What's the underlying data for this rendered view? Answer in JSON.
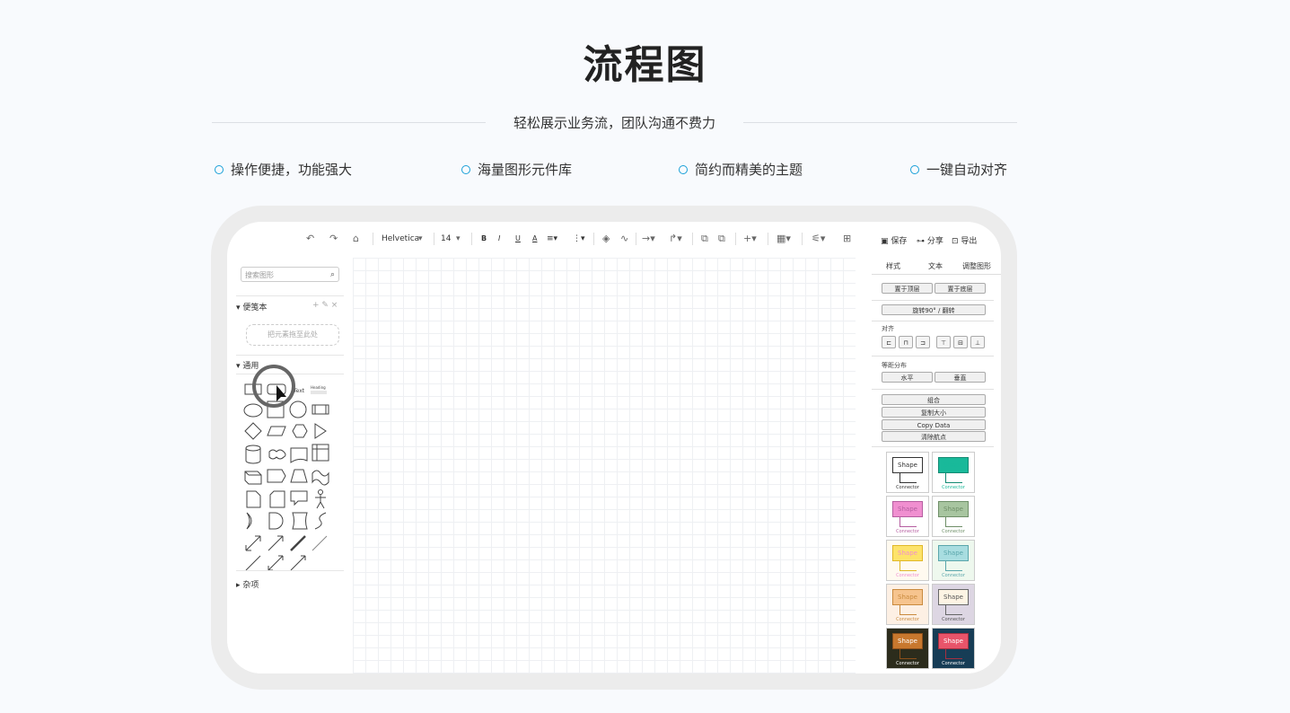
{
  "title": "流程图",
  "subtitle": "轻松展示业务流，团队沟通不费力",
  "features": [
    "操作便捷，功能强大",
    "海量图形元件库",
    "简约而精美的主题",
    "一键自动对齐"
  ],
  "accent_color": "#1aa0d8",
  "editor": {
    "toolbar": {
      "font": "Helvetica",
      "font_size": "14",
      "bold": "B",
      "italic": "I",
      "underline": "U",
      "font_color": "A",
      "save": "保存",
      "share": "分享",
      "export": "导出"
    },
    "left_panel": {
      "search_placeholder": "搜索图形",
      "scratchpad_title": "便笺本",
      "scratchpad_actions": "+ ✎ ×",
      "dropzone_text": "把元素拖至此处",
      "general_title": "通用",
      "misc_title": "杂项",
      "text_shape": "Text",
      "heading_shape": "Heading"
    },
    "right_panel": {
      "tabs": [
        "样式",
        "文本",
        "调整图形"
      ],
      "to_front": "置于顶层",
      "to_back": "置于底层",
      "rotate": "旋转90° / 翻转",
      "align_label": "对齐",
      "distribute_label": "等距分布",
      "horizontal": "水平",
      "vertical": "垂直",
      "group": "组合",
      "copy_size": "复制大小",
      "copy_data": "Copy Data",
      "clear_waypoints": "清除航点",
      "themes": [
        {
          "shape": "Shape",
          "connector": "Connector",
          "fill": "#ffffff",
          "stroke": "#333333",
          "bg": "#ffffff",
          "text": "#333333"
        },
        {
          "shape": "Shape",
          "connector": "Connector",
          "fill": "#19b99a",
          "stroke": "#138a73",
          "bg": "#ffffff",
          "text": "#19b99a"
        },
        {
          "shape": "Shape",
          "connector": "Connector",
          "fill": "#f08fd0",
          "stroke": "#b55ea0",
          "bg": "#ffffff",
          "text": "#b55ea0"
        },
        {
          "shape": "Shape",
          "connector": "Connector",
          "fill": "#a8c5a0",
          "stroke": "#6f8f68",
          "bg": "#ffffff",
          "text": "#6f8f68"
        },
        {
          "shape": "Shape",
          "connector": "Connector",
          "fill": "#fde36a",
          "stroke": "#e0b828",
          "bg": "#fffaf0",
          "text": "#f08fd0"
        },
        {
          "shape": "Shape",
          "connector": "Connector",
          "fill": "#a8dde0",
          "stroke": "#5aa6ab",
          "bg": "#eef8ee",
          "text": "#5aa6ab"
        },
        {
          "shape": "Shape",
          "connector": "Connector",
          "fill": "#f6c48e",
          "stroke": "#c98a3e",
          "bg": "#fdf0e4",
          "text": "#c98a3e"
        },
        {
          "shape": "Shape",
          "connector": "Connector",
          "fill": "#fdf4e4",
          "stroke": "#666666",
          "bg": "#ddd6e3",
          "text": "#555555"
        },
        {
          "shape": "Shape",
          "connector": "Connector",
          "fill": "#c8782e",
          "stroke": "#8a4e1a",
          "bg": "#2c2c1c",
          "text": "#ffffff"
        },
        {
          "shape": "Shape",
          "connector": "Connector",
          "fill": "#e8546a",
          "stroke": "#a53040",
          "bg": "#173d56",
          "text": "#ffffff"
        }
      ]
    }
  }
}
